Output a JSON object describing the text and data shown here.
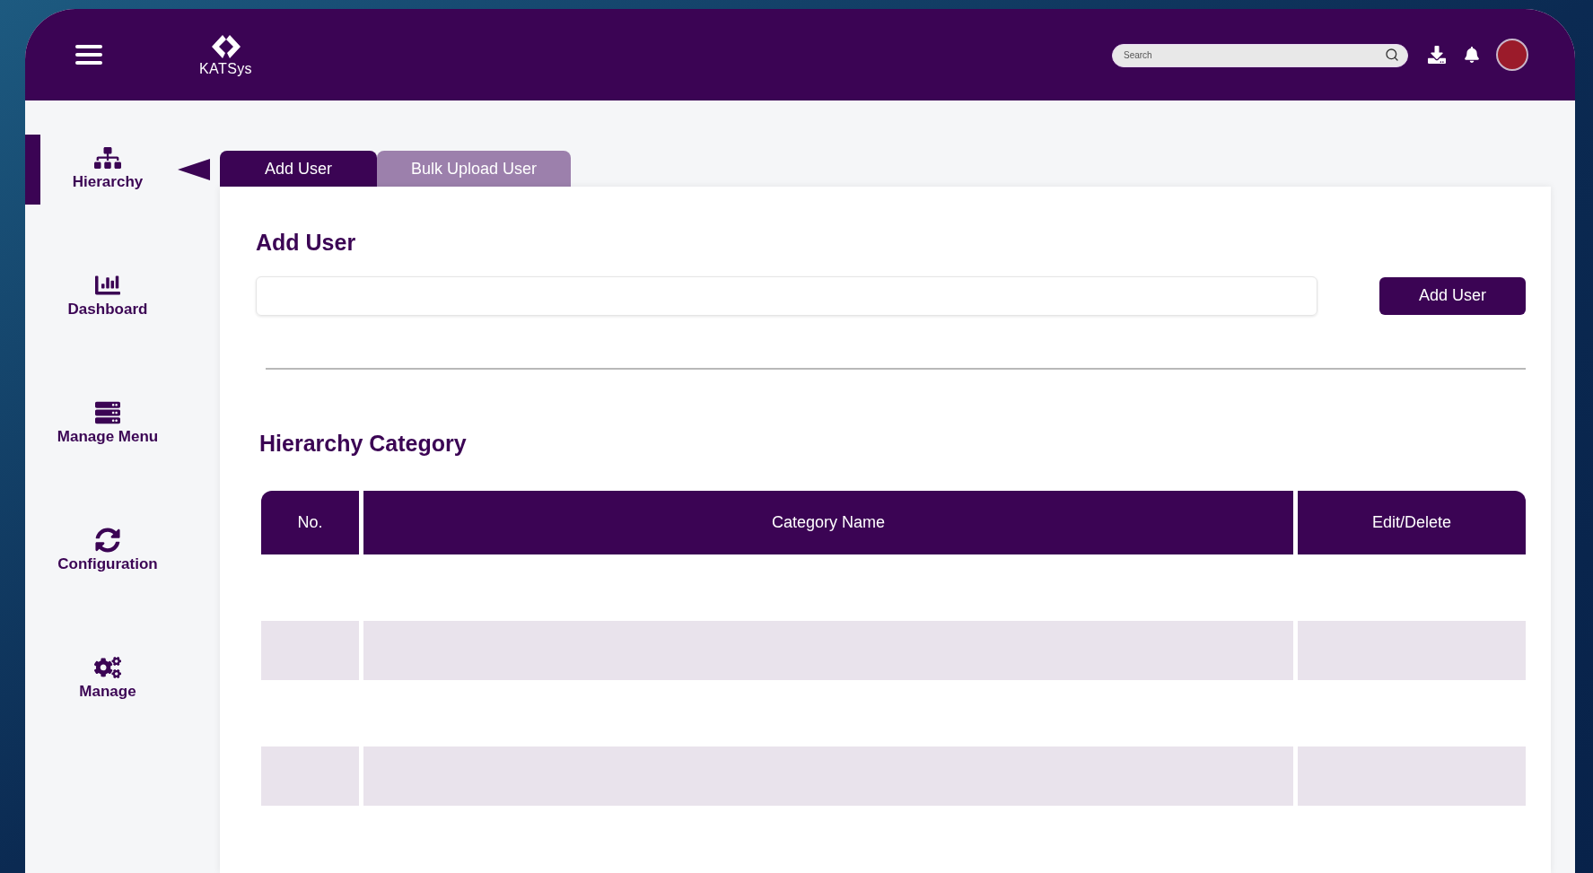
{
  "header": {
    "logo": "KATSys",
    "search": {
      "placeholder": "Search"
    }
  },
  "sidebar": {
    "items": [
      {
        "kind": "hierarchy",
        "label": "Hierarchy",
        "selected": true
      },
      {
        "kind": "dashboard",
        "label": "Dashboard",
        "selected": false
      },
      {
        "kind": "menu",
        "label": "Manage Menu",
        "selected": false
      },
      {
        "kind": "configuration",
        "label": "Configuration",
        "selected": false
      },
      {
        "kind": "manage",
        "label": "Manage",
        "selected": false
      }
    ]
  },
  "tabs": [
    {
      "label": "Add User",
      "selected": true
    },
    {
      "label": "Bulk Upload User",
      "selected": false
    }
  ],
  "form": {
    "title": "Add User",
    "button": "Add User"
  },
  "table": {
    "title": "Hierarchy Category",
    "columns": [
      "No.",
      "Category Name",
      "Edit/Delete"
    ]
  }
}
